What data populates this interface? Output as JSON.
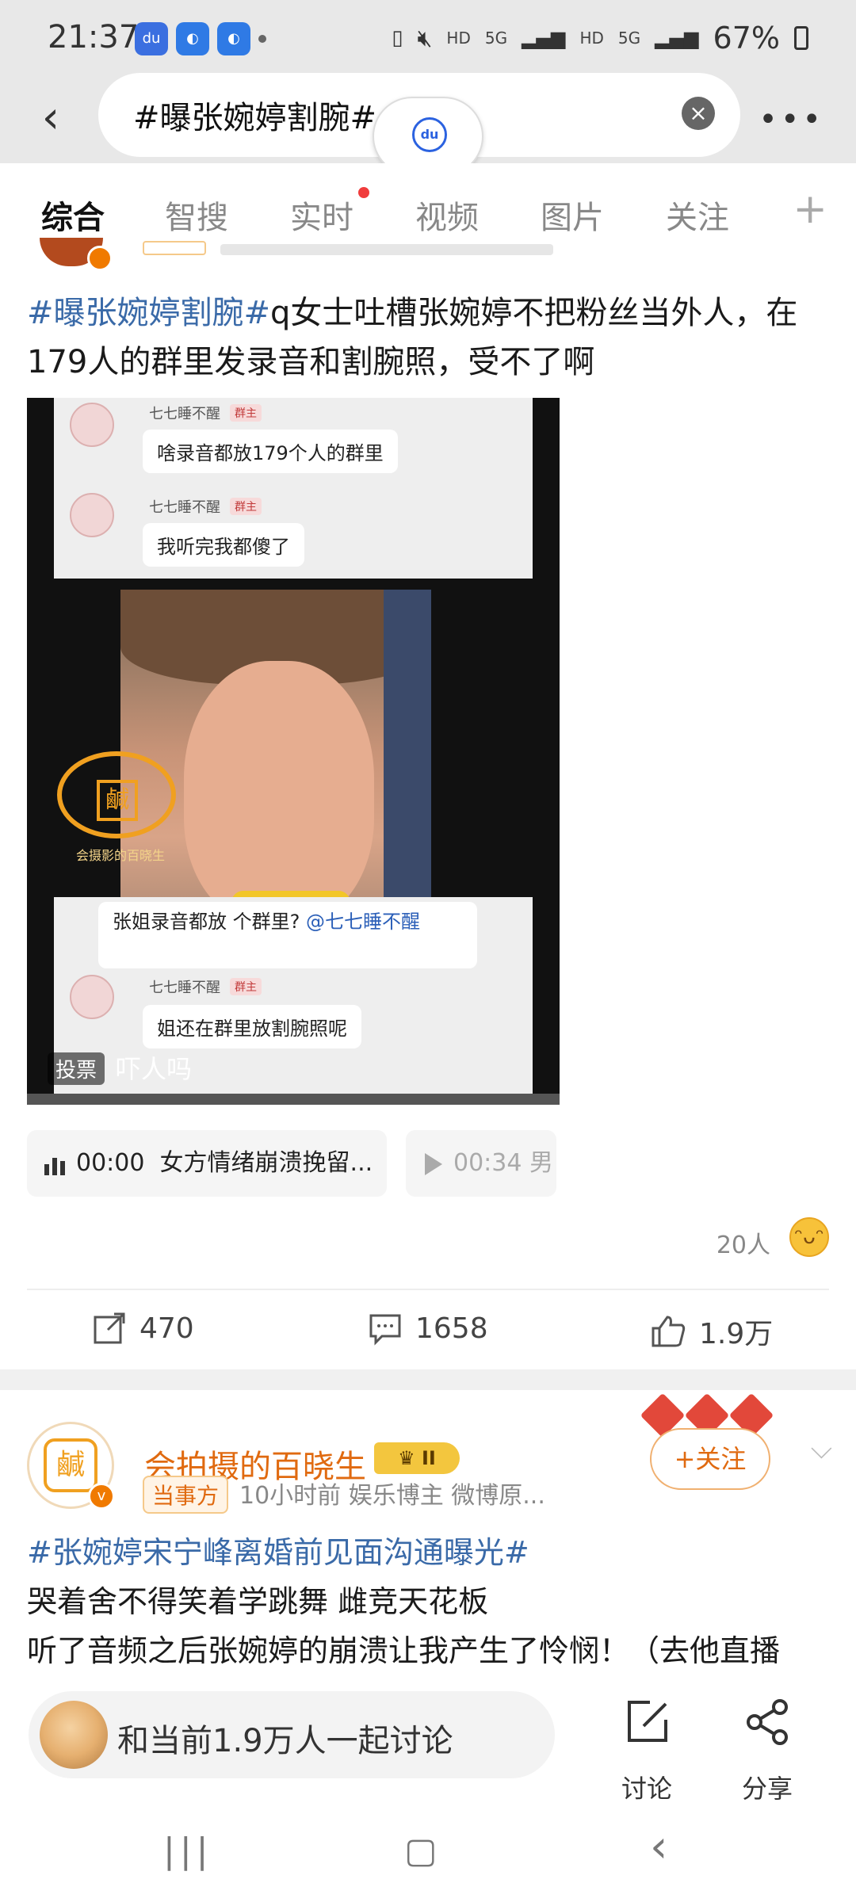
{
  "status_bar": {
    "time": "21:37",
    "app_icons": [
      "baidu-icon",
      "browser-icon",
      "browser-icon"
    ],
    "hd1": "HD",
    "net1": "5G",
    "hd2": "HD",
    "net2": "5G",
    "battery": "67%"
  },
  "search": {
    "query": "#曝张婉婷割腕#",
    "float_badge": "du"
  },
  "tabs": [
    {
      "label": "综合"
    },
    {
      "label": "智搜"
    },
    {
      "label": "实时"
    },
    {
      "label": "视频"
    },
    {
      "label": "图片"
    },
    {
      "label": "关注"
    }
  ],
  "post1": {
    "tag": "#曝张婉婷割腕#",
    "text": "q女士吐槽张婉婷不把粉丝当外人，在179人的群里发录音和割腕照，受不了啊",
    "media": {
      "chat": [
        {
          "name": "七七睡不醒",
          "role": "群主",
          "message": "啥录音都放179个人的群里"
        },
        {
          "name": "七七睡不醒",
          "role": "群主",
          "message": "我听完我都傻了"
        },
        {
          "message": "张姐录音都放 个群里?",
          "mention": "@七七睡不醒"
        },
        {
          "name": "七七睡不醒",
          "role": "群主",
          "message": "姐还在群里放割腕照呢"
        }
      ],
      "watermark_char": "鹹",
      "watermark_caption": "会摄影的百晓生",
      "vote_label": "投票",
      "vote_text": "吓人吗"
    },
    "audio": [
      {
        "time": "00:00",
        "title": "女方情绪崩溃挽留..."
      },
      {
        "time": "00:34",
        "title": "男"
      }
    ],
    "people_count": "20人",
    "actions": {
      "repost": "470",
      "comment": "1658",
      "like": "1.9万"
    }
  },
  "post2": {
    "author": "会拍摄的百晓生",
    "level": "II",
    "role_badge": "当事方",
    "meta": "10小时前  娱乐博主 微博原...",
    "follow_label": "+关注",
    "tag": "#张婉婷宋宁峰离婚前见面沟通曝光#",
    "line1": "哭着舍不得笑着学跳舞 雌竞天花板",
    "line2": "听了音频之后张婉婷的崩溃让我产生了怜悯！（去他直播"
  },
  "bottom_bar": {
    "discuss_placeholder": "和当前1.9万人一起讨论",
    "discuss_btn": "讨论",
    "share_btn": "分享"
  },
  "colors": {
    "accent_orange": "#f08a00",
    "tag_blue": "#3a6aa8",
    "name_orange": "#e06a10"
  }
}
